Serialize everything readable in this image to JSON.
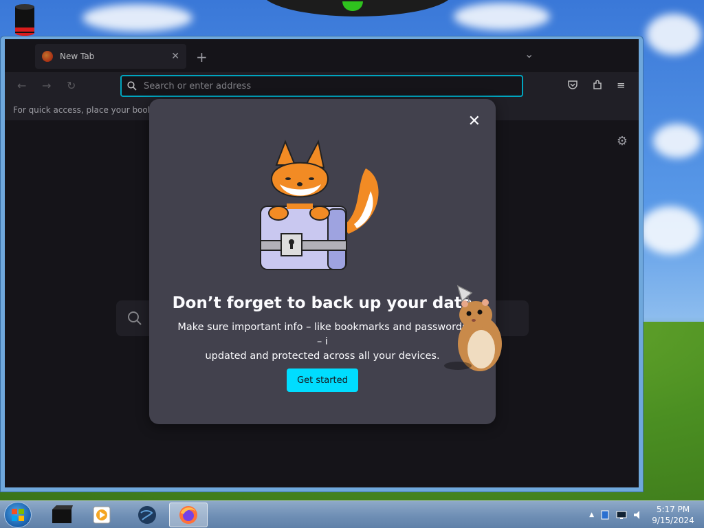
{
  "desktop": {
    "hat_icon": "top-hat-icon",
    "dock_icon": "dock-bar-icon"
  },
  "browser": {
    "tab": {
      "title": "New Tab",
      "close_glyph": "✕"
    },
    "new_tab_glyph": "+",
    "tabs_list_glyph": "⌄",
    "window_controls": {
      "minimize": "–",
      "maximize": "□",
      "close": "✕"
    },
    "nav": {
      "back_glyph": "←",
      "forward_glyph": "→",
      "reload_glyph": "↻"
    },
    "urlbar": {
      "placeholder": "Search or enter address",
      "value": ""
    },
    "toolbar": {
      "pocket_icon": "pocket-icon",
      "extensions_icon": "extensions-icon",
      "menu_glyph": "≡"
    },
    "bookmarks_bar_text": "For quick access, place your bookmark",
    "settings_glyph": "⚙"
  },
  "modal": {
    "close_glyph": "✕",
    "title": "Don’t forget to back up your data",
    "body_line1": "Make sure important info – like bookmarks and passwords – i",
    "body_line2": "updated and protected across all your devices.",
    "cta_label": "Get started"
  },
  "taskbar": {
    "items": [
      "media-box-icon",
      "media-player-icon",
      "globe-icon",
      "firefox-icon"
    ],
    "active_item": "firefox-icon",
    "tray": {
      "show_hidden_glyph": "▲"
    },
    "clock": {
      "time": "5:17 PM",
      "date": "9/15/2024"
    }
  },
  "colors": {
    "accent": "#00ddff",
    "modal_bg": "#42414d",
    "browser_bg": "#1c1b22",
    "toolbar_bg": "#2b2a33"
  }
}
